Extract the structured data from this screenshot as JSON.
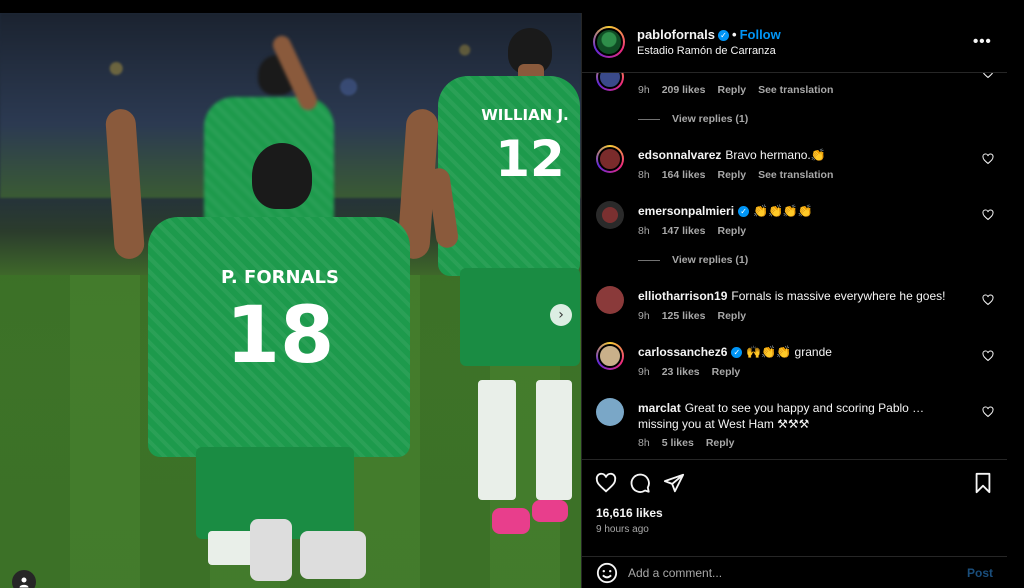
{
  "post": {
    "username": "pablofornals",
    "verified_mark": "✓",
    "separator": "•",
    "follow_label": "Follow",
    "location": "Estadio Ramón de Carranza",
    "more_label": "•••",
    "next_arrow": "›",
    "photo_number": "18",
    "photo_name": "P. FORNALS",
    "photo_number_2": "12",
    "photo_name_2": "WILLIAN J."
  },
  "comments": [
    {
      "username": "",
      "verified": true,
      "text": "",
      "time": "9h",
      "likes": "209 likes",
      "reply": "Reply",
      "translate": "See translation",
      "avatar_color": "#3a4a8a"
    },
    {
      "view_replies": "View replies (1)"
    },
    {
      "username": "edsonnalvarez",
      "verified": false,
      "text": "Bravo hermano.👏",
      "time": "8h",
      "likes": "164 likes",
      "reply": "Reply",
      "translate": "See translation",
      "avatar_color": "#7a2b2b"
    },
    {
      "username": "emersonpalmieri",
      "verified": true,
      "text": "👏👏👏👏",
      "time": "8h",
      "likes": "147 likes",
      "reply": "Reply",
      "avatar_color": "#2a2a2a"
    },
    {
      "view_replies": "View replies (1)"
    },
    {
      "username": "elliotharrison19",
      "verified": false,
      "text": "Fornals is massive everywhere he goes!",
      "time": "9h",
      "likes": "125 likes",
      "reply": "Reply",
      "avatar_color": "#8a3a3a"
    },
    {
      "username": "carlossanchez6",
      "verified": true,
      "text": "🙌👏👏 grande",
      "time": "9h",
      "likes": "23 likes",
      "reply": "Reply",
      "avatar_color": "#c9b08a"
    },
    {
      "username": "marclat",
      "verified": false,
      "text": "Great to see you happy and scoring Pablo … missing you at West Ham ⚒⚒⚒",
      "time": "8h",
      "likes": "5 likes",
      "reply": "Reply",
      "avatar_color": "#7aa7c7"
    }
  ],
  "actions": {
    "likes": "16,616 likes",
    "time": "9 hours ago",
    "comment_placeholder": "Add a comment...",
    "post_label": "Post"
  },
  "colors": {
    "accent": "#0095f6",
    "background": "#000000",
    "muted_text": "#a8a8a8",
    "kit_green": "#1d9a4c"
  },
  "icons": [
    "verified-badge-icon",
    "more-options-icon",
    "heart-icon",
    "comment-icon",
    "share-icon",
    "bookmark-icon",
    "emoji-icon",
    "next-arrow-icon",
    "user-tag-icon"
  ]
}
